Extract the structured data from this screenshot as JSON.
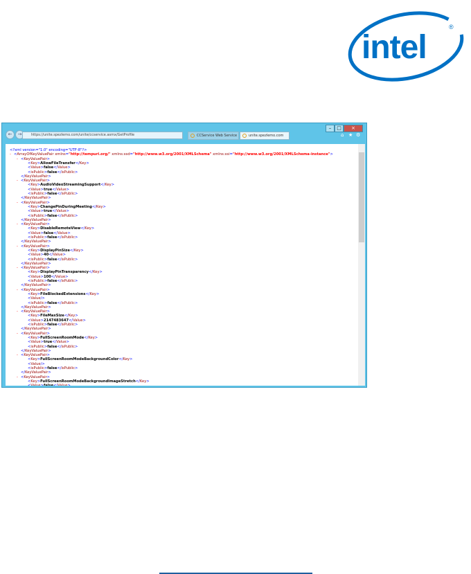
{
  "brand": {
    "logo_text": "intel",
    "color": "#0071c5"
  },
  "browser": {
    "address": "https://unite.spezlemo.com/unite/ccservice.asmx/GetProfile",
    "tabs": [
      {
        "label": "CCService Web Service"
      },
      {
        "label": "unite.spezlemo.com"
      }
    ],
    "window_buttons": [
      "–",
      "□",
      "×"
    ]
  },
  "xml": {
    "declaration": "<?xml version=\"1.0\" encoding=\"UTF-8\"?>",
    "root": {
      "name": "ArrayOfKeyValuePair",
      "attrs": [
        [
          "xmlns",
          "http://tempuri.org/"
        ],
        [
          "xmlns:xsd",
          "http://www.w3.org/2001/XMLSchema"
        ],
        [
          "xmlns:xsi",
          "http://www.w3.org/2001/XMLSchema-instance"
        ]
      ]
    },
    "pairs": [
      {
        "key": "AllowFileTransfer",
        "value": "false",
        "isPublic": "false"
      },
      {
        "key": "AudioVideoStreamingSupport",
        "value": "true",
        "isPublic": "false"
      },
      {
        "key": "ChangePinDuringMeeting",
        "value": "true",
        "isPublic": "false"
      },
      {
        "key": "DisableRemoteView",
        "value": "false",
        "isPublic": "false"
      },
      {
        "key": "DisplayPinSize",
        "value": "40",
        "isPublic": "false"
      },
      {
        "key": "DisplayPinTransparency",
        "value": "100",
        "isPublic": "false"
      },
      {
        "key": "FileBlockedExtensions",
        "value": null,
        "isPublic": "false"
      },
      {
        "key": "FileMaxSize",
        "value": "2147483647",
        "isPublic": "false"
      },
      {
        "key": "FullScreenRoomMode",
        "value": "true",
        "isPublic": "false"
      },
      {
        "key": "FullScreenRoomModeBackgroundColor",
        "value": null,
        "isPublic": "false"
      },
      {
        "key": "FullScreenRoomModeBackgroundImageStretch",
        "value": "false",
        "isPublic": "false"
      }
    ]
  }
}
